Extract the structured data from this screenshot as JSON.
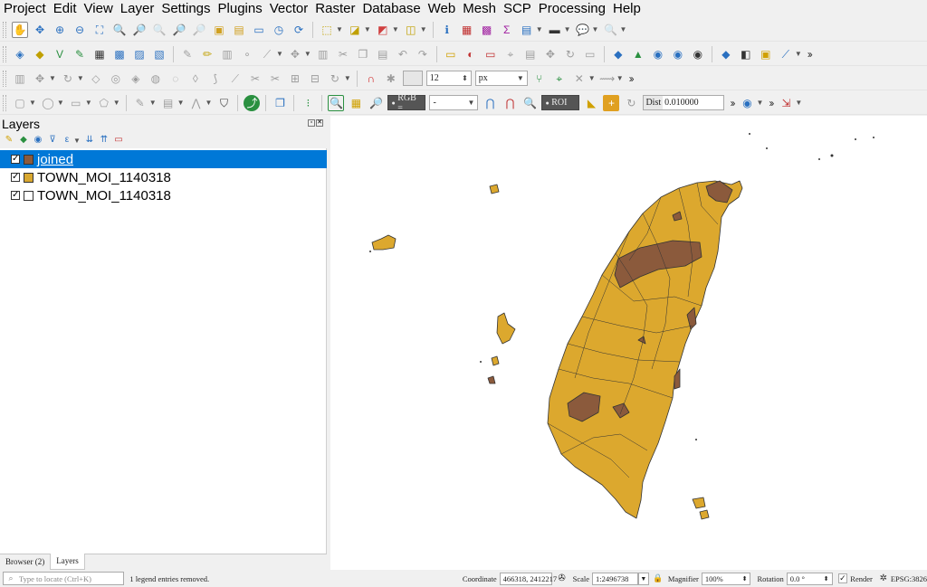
{
  "menu": [
    "Project",
    "Edit",
    "View",
    "Layer",
    "Settings",
    "Plugins",
    "Vector",
    "Raster",
    "Database",
    "Web",
    "Mesh",
    "SCP",
    "Processing",
    "Help"
  ],
  "toolbar_snap": {
    "tolerance_value": "12",
    "unit": "px"
  },
  "toolbar_scp": {
    "rgb_label": "RGB =",
    "rgb_value": "-",
    "roi_label": "ROI",
    "dist_label": "Dist",
    "dist_value": "0.010000"
  },
  "layers_panel": {
    "title": "Layers",
    "layers": [
      {
        "name": "joined",
        "checked": "✓",
        "color": "#8B5A3C",
        "selected": true
      },
      {
        "name": "TOWN_MOI_1140318",
        "checked": "✓",
        "color": "#D9A830",
        "selected": false
      },
      {
        "name": "TOWN_MOI_1140318",
        "checked": "✓",
        "color": "#ffffff",
        "selected": false
      }
    ],
    "tabs": [
      "Browser (2)",
      "Layers"
    ]
  },
  "map": {
    "fill_color": "#DCA82E",
    "joined_color": "#8B5A3C",
    "outline_color": "#333333"
  },
  "statusbar": {
    "locate_placeholder": "Type to locate (Ctrl+K)",
    "message": "1 legend entries removed.",
    "coordinate_label": "Coordinate",
    "coordinate_value": "466318, 2412217",
    "scale_label": "Scale",
    "scale_value": "1:2496738",
    "magnifier_label": "Magnifier",
    "magnifier_value": "100%",
    "rotation_label": "Rotation",
    "rotation_value": "0.0 °",
    "render_label": "Render",
    "crs": "EPSG:3826"
  }
}
